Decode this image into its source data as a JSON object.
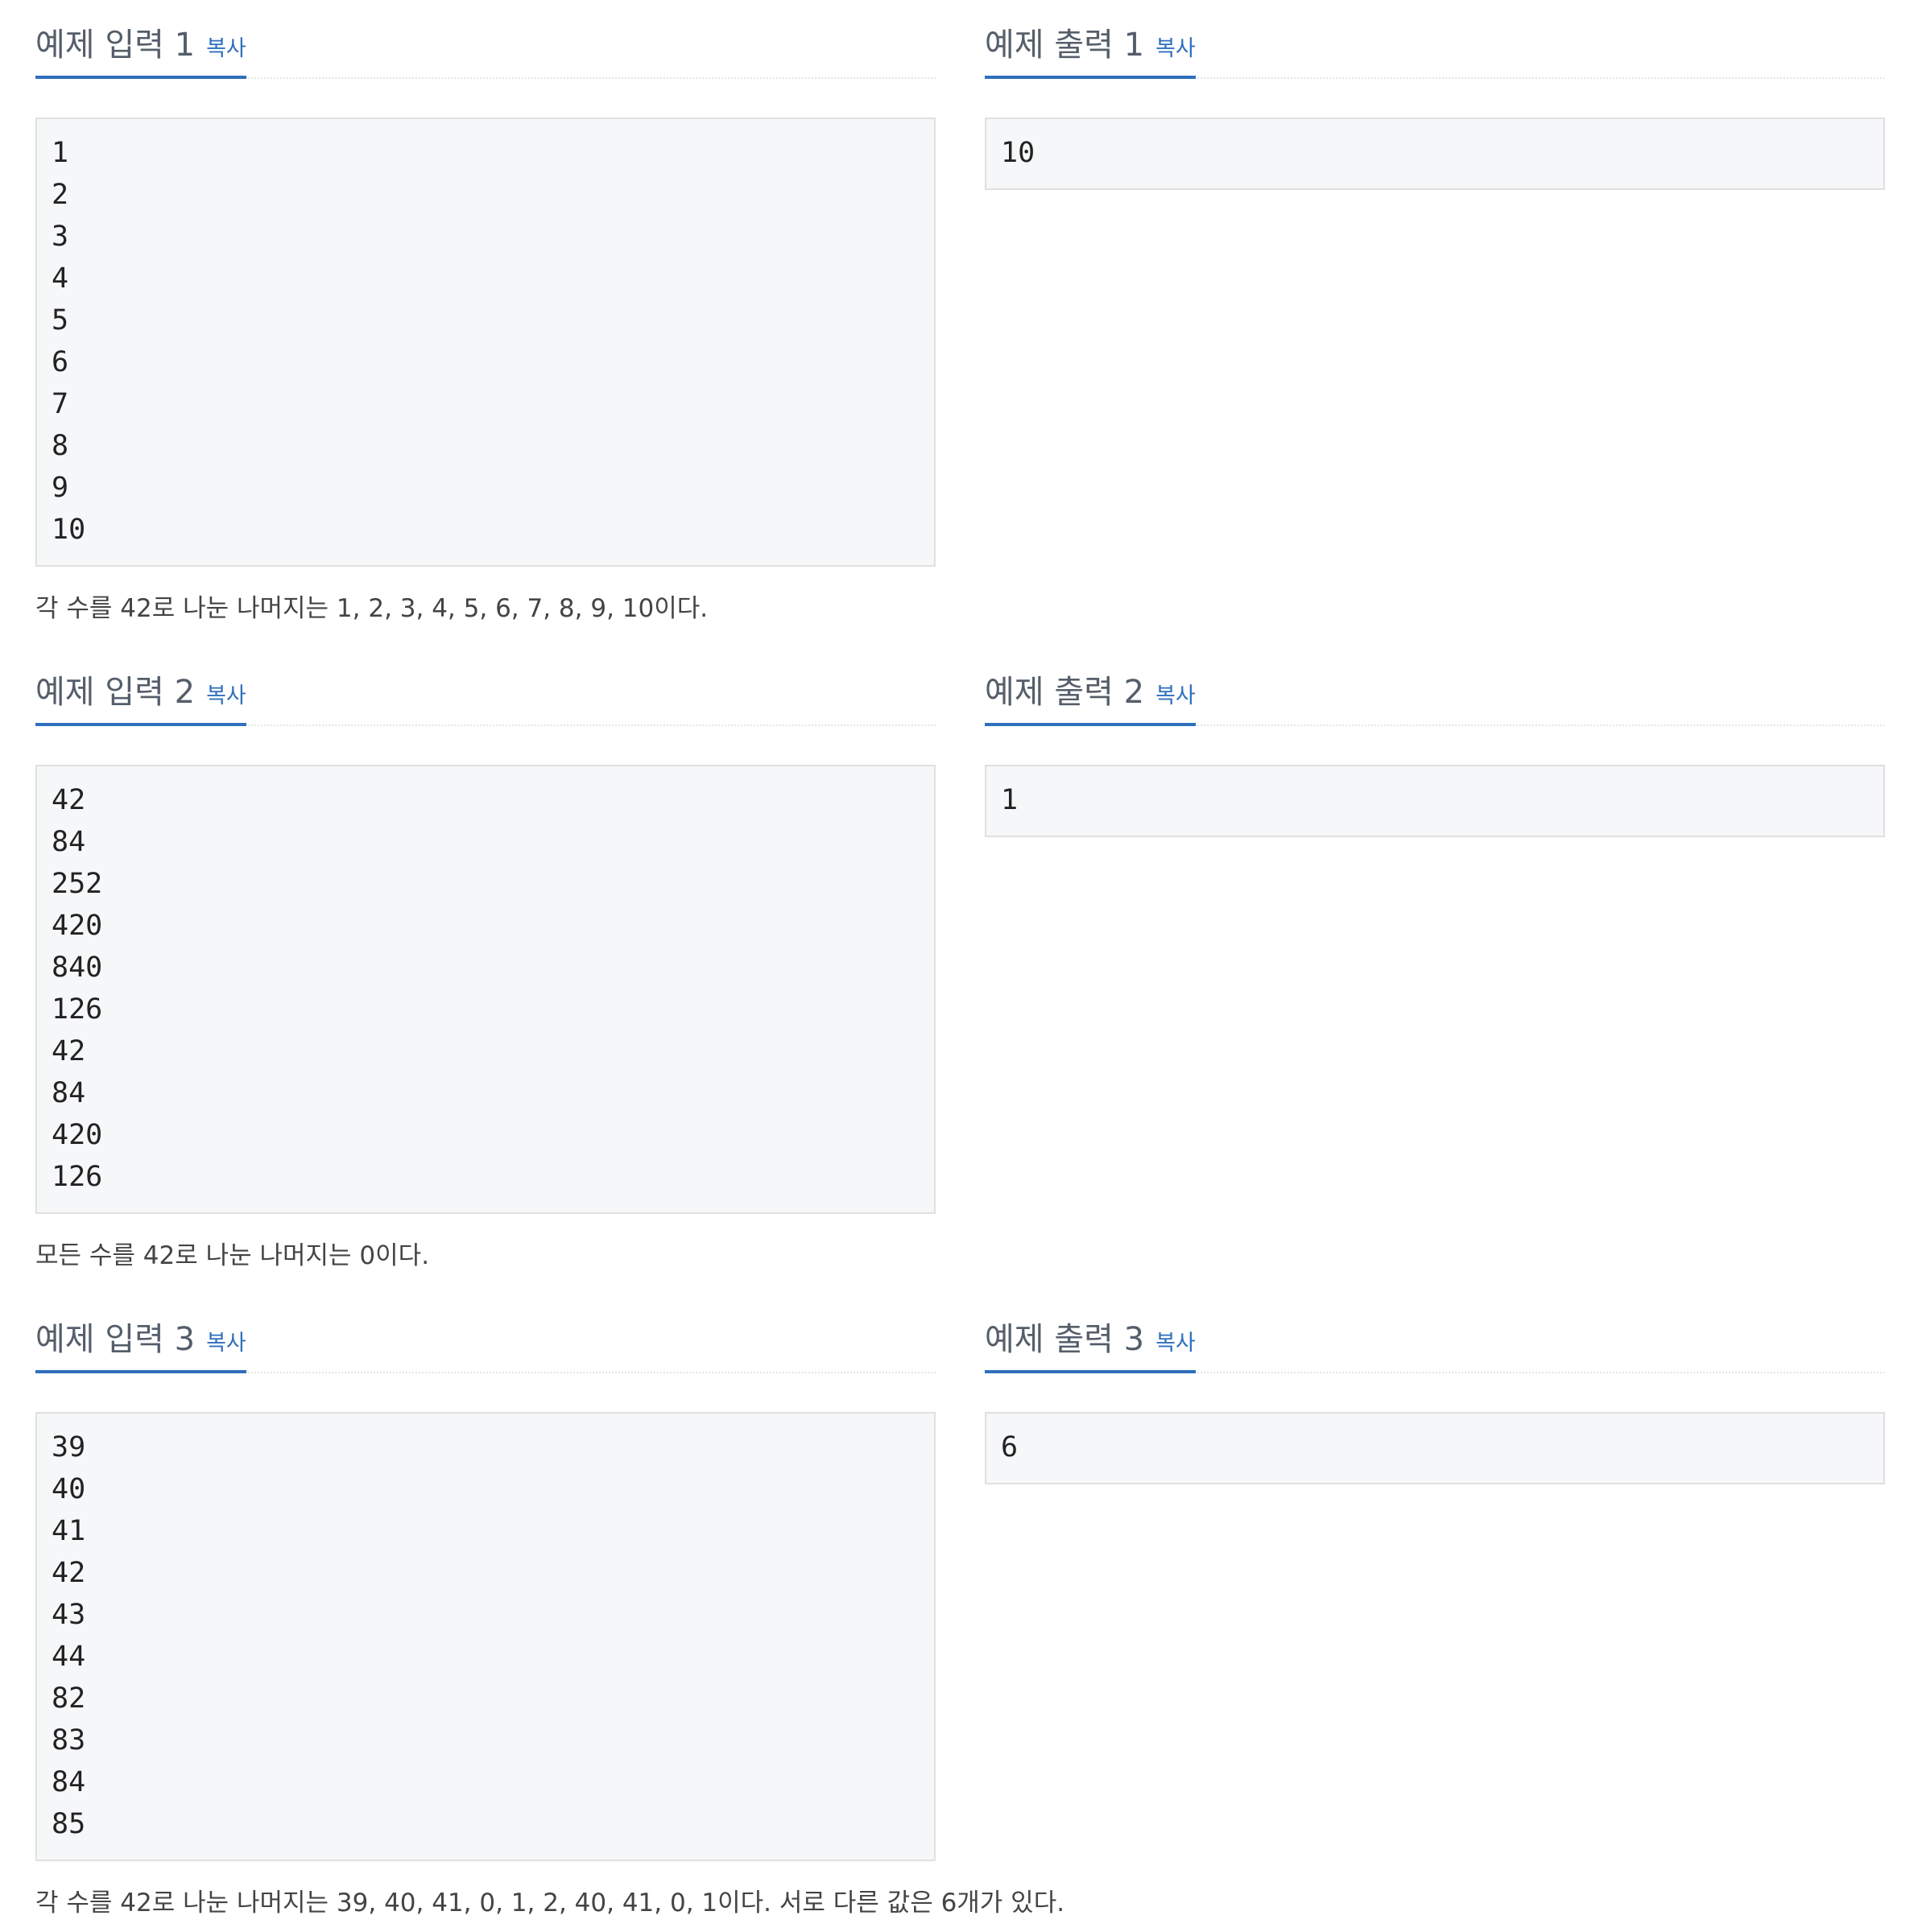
{
  "copy_label": "복사",
  "samples": [
    {
      "input_title": "예제 입력 1",
      "output_title": "예제 출력 1",
      "input_lines": [
        "1",
        "2",
        "3",
        "4",
        "5",
        "6",
        "7",
        "8",
        "9",
        "10"
      ],
      "output_lines": [
        "10"
      ],
      "explanation": "각 수를 42로 나눈 나머지는 1, 2, 3, 4, 5, 6, 7, 8, 9, 10이다."
    },
    {
      "input_title": "예제 입력 2",
      "output_title": "예제 출력 2",
      "input_lines": [
        "42",
        "84",
        "252",
        "420",
        "840",
        "126",
        "42",
        "84",
        "420",
        "126"
      ],
      "output_lines": [
        "1"
      ],
      "explanation": "모든 수를 42로 나눈 나머지는 0이다."
    },
    {
      "input_title": "예제 입력 3",
      "output_title": "예제 출력 3",
      "input_lines": [
        "39",
        "40",
        "41",
        "42",
        "43",
        "44",
        "82",
        "83",
        "84",
        "85"
      ],
      "output_lines": [
        "6"
      ],
      "explanation": "각 수를 42로 나눈 나머지는 39, 40, 41, 0, 1, 2, 40, 41, 0, 1이다. 서로 다른 값은 6개가 있다."
    }
  ]
}
